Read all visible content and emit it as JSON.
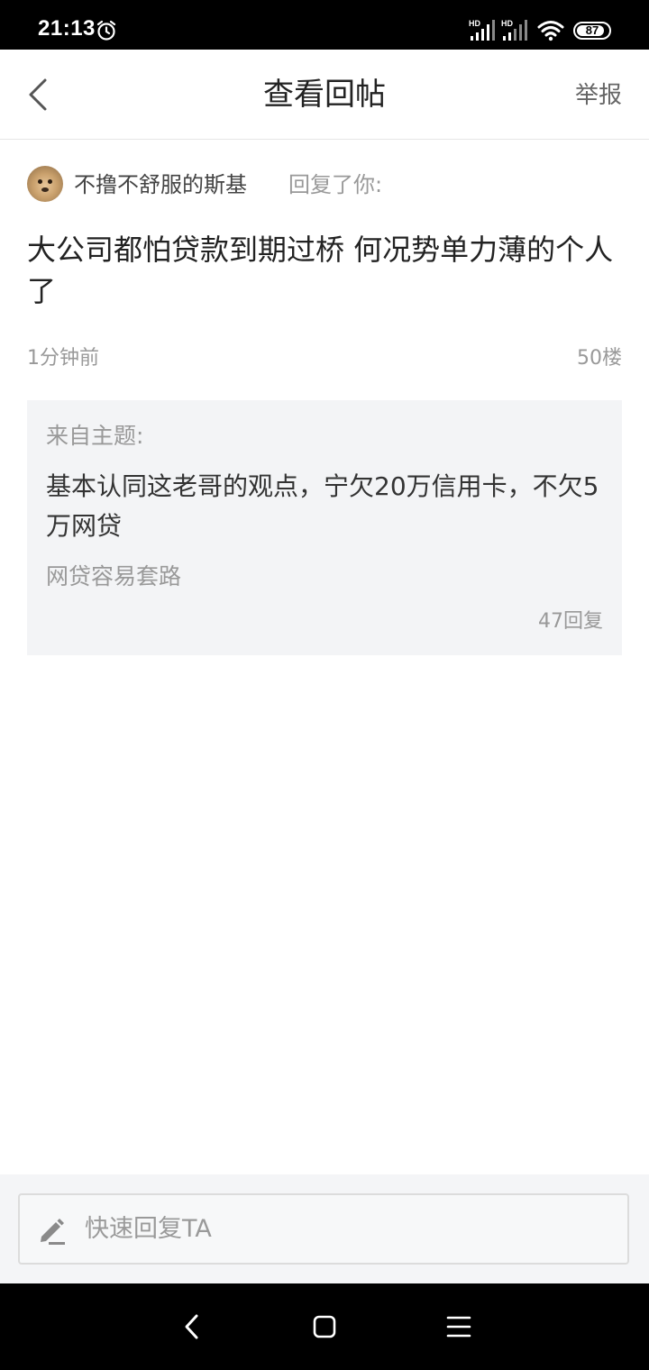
{
  "status_bar": {
    "time": "21:13",
    "battery_level": "87",
    "icons": [
      "alarm-icon",
      "signal-hd-icon",
      "signal-hd-icon",
      "wifi-icon",
      "battery-icon"
    ]
  },
  "navbar": {
    "title": "查看回帖",
    "report_label": "举报",
    "back_icon": "chevron-left-icon"
  },
  "post": {
    "username": "不撸不舒服的斯基",
    "replied_label": "回复了你:",
    "content": "大公司都怕贷款到期过桥 何况势单力薄的个人了",
    "timestamp": "1分钟前",
    "floor": "50楼"
  },
  "topic": {
    "label": "来自主题:",
    "title": "基本认同这老哥的观点，宁欠20万信用卡，不欠5万网贷",
    "forum": "网贷容易套路",
    "reply_count": "47回复"
  },
  "reply_bar": {
    "placeholder": "快速回复TA",
    "icon": "pencil-icon"
  },
  "system_nav": {
    "icons": [
      "back-triangle-icon",
      "home-square-icon",
      "menu-lines-icon"
    ]
  },
  "colors": {
    "status_bar_bg": "#000000",
    "card_bg": "#f3f4f6",
    "muted_text": "#999999",
    "primary_text": "#222222"
  }
}
